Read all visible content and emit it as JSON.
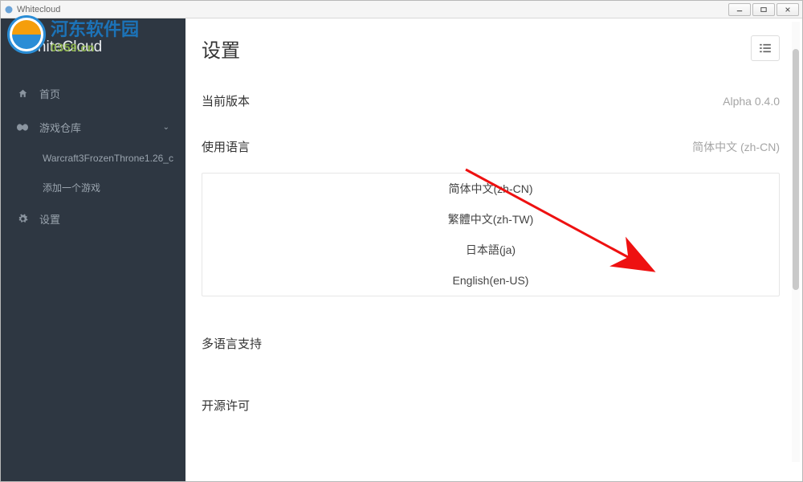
{
  "titlebar": {
    "title": "Whitecloud"
  },
  "watermark": {
    "cn": "河东软件园",
    "url": "0359.cn"
  },
  "sidebar": {
    "brand": "WhiteCloud",
    "home": "首页",
    "library": "游戏仓库",
    "sub_game": "Warcraft3FrozenThrone1.26_c",
    "sub_add": "添加一个游戏",
    "settings": "设置"
  },
  "main": {
    "title": "设置",
    "version_label": "当前版本",
    "version_value": "Alpha 0.4.0",
    "lang_label": "使用语言",
    "lang_value": "简体中文 (zh-CN)",
    "multilang_label": "多语言支持",
    "license_label": "开源许可",
    "languages": {
      "0": "简体中文(zh-CN)",
      "1": "繁體中文(zh-TW)",
      "2": "日本語(ja)",
      "3": "English(en-US)"
    }
  }
}
